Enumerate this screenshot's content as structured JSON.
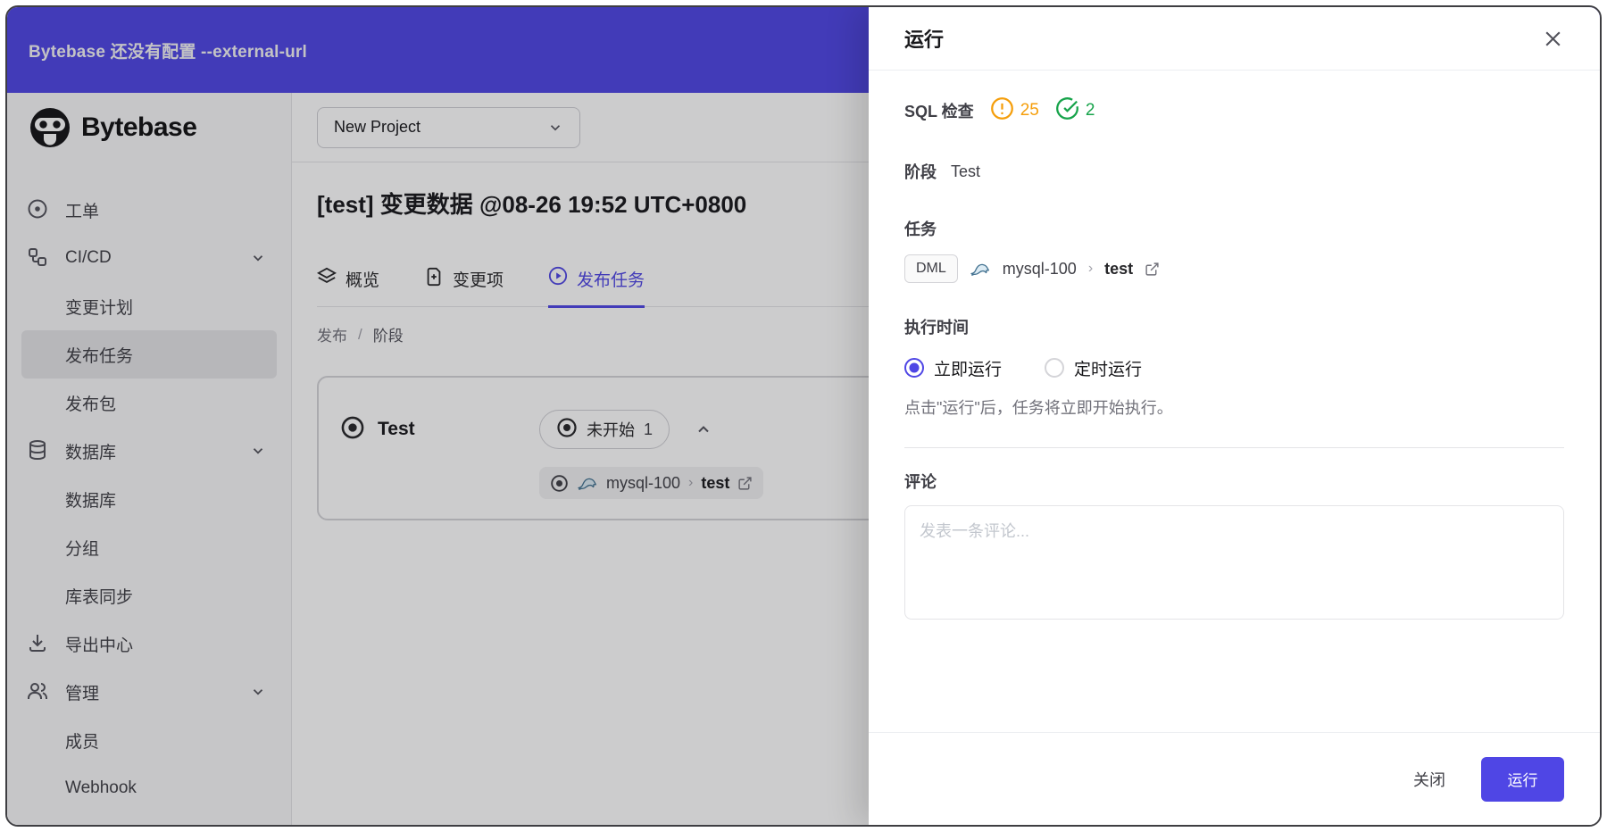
{
  "colors": {
    "accent": "#4f46e5",
    "warning": "#f59e0b",
    "success": "#16a34a",
    "mysql": "#41708f"
  },
  "banner": {
    "text": "Bytebase 还没有配置 --external-url"
  },
  "sidebar": {
    "logo_text": "Bytebase",
    "items": [
      {
        "label": "工单"
      },
      {
        "label": "CI/CD"
      },
      {
        "label": "变更计划"
      },
      {
        "label": "发布任务"
      },
      {
        "label": "发布包"
      },
      {
        "label": "数据库"
      },
      {
        "label": "数据库"
      },
      {
        "label": "分组"
      },
      {
        "label": "库表同步"
      },
      {
        "label": "导出中心"
      },
      {
        "label": "管理"
      },
      {
        "label": "成员"
      },
      {
        "label": "Webhook"
      }
    ]
  },
  "main": {
    "project_selector": "New Project",
    "title": "[test] 变更数据 @08-26 19:52 UTC+0800",
    "tabs": [
      {
        "label": "概览"
      },
      {
        "label": "变更项"
      },
      {
        "label": "发布任务"
      }
    ],
    "breadcrumb": {
      "first": "发布",
      "second": "阶段"
    },
    "stage_card": {
      "stage_name": "Test",
      "status_label": "未开始",
      "status_count": "1",
      "task": {
        "instance": "mysql-100",
        "database": "test"
      }
    }
  },
  "drawer": {
    "title": "运行",
    "sql_check": {
      "label": "SQL 检查",
      "warning_count": "25",
      "success_count": "2"
    },
    "stage": {
      "label": "阶段",
      "value": "Test"
    },
    "task": {
      "label": "任务",
      "badge": "DML",
      "instance": "mysql-100",
      "database": "test"
    },
    "execution": {
      "label": "执行时间",
      "option_now": "立即运行",
      "option_scheduled": "定时运行",
      "hint": "点击\"运行\"后，任务将立即开始执行。"
    },
    "comment": {
      "label": "评论",
      "placeholder": "发表一条评论..."
    },
    "footer": {
      "cancel": "关闭",
      "run": "运行"
    }
  }
}
